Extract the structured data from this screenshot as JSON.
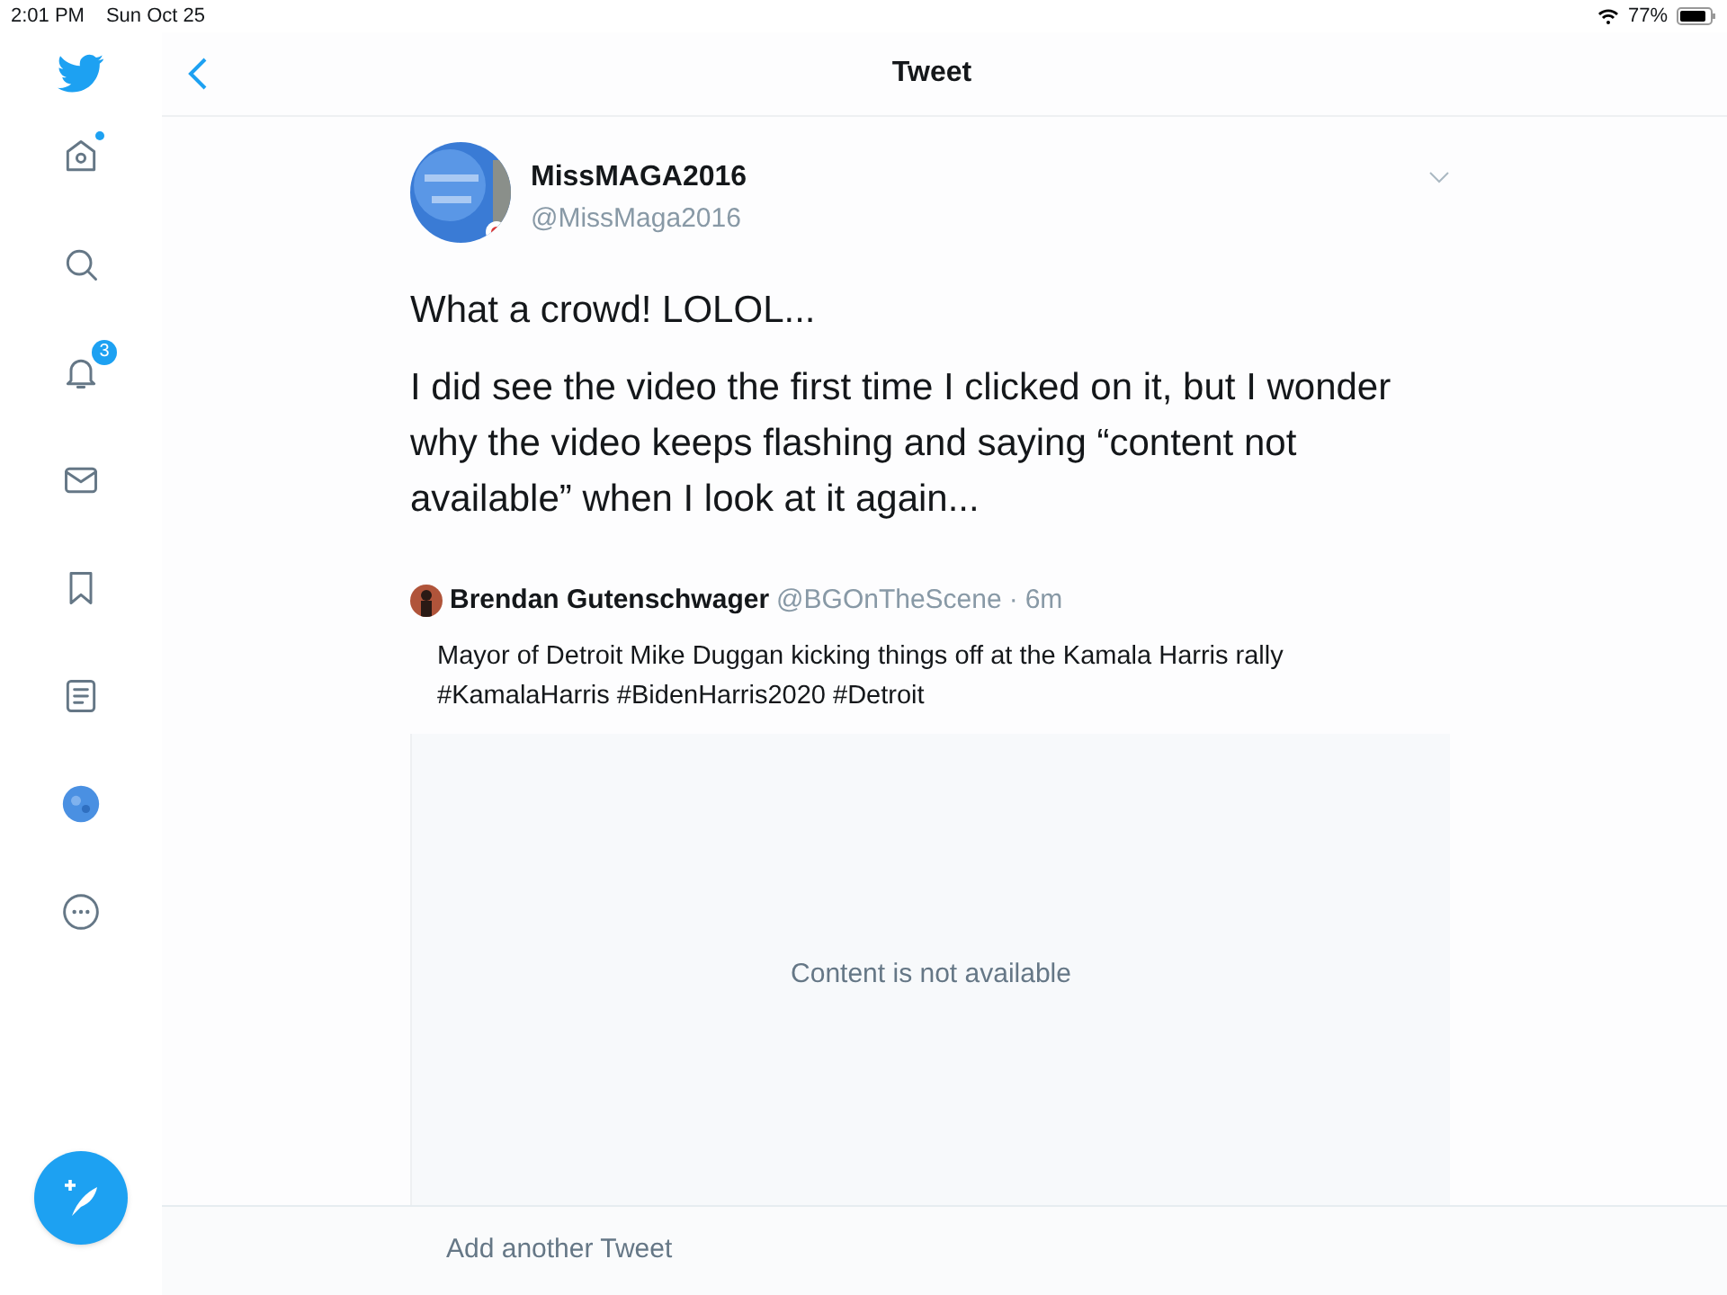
{
  "status_bar": {
    "time": "2:01 PM",
    "date": "Sun Oct 25",
    "battery": "77%"
  },
  "header": {
    "title": "Tweet"
  },
  "sidebar": {
    "items": [
      {
        "kind": "home",
        "dot": true
      },
      {
        "kind": "search",
        "dot": false
      },
      {
        "kind": "notifications",
        "dot": false,
        "badge": "3"
      },
      {
        "kind": "messages",
        "dot": false
      },
      {
        "kind": "bookmarks",
        "dot": false
      },
      {
        "kind": "lists",
        "dot": false
      },
      {
        "kind": "profile",
        "dot": false
      },
      {
        "kind": "more",
        "dot": false
      }
    ]
  },
  "tweet": {
    "author": "MissMAGA2016",
    "handle": "@MissMaga2016",
    "paragraphs": [
      "What a crowd! LOLOL...",
      "I did see the video the first time I clicked on it, but I wonder why the video keeps flashing and saying “content not available” when I look at it again..."
    ],
    "quote": {
      "author": "Brendan Gutenschwager",
      "handle": "@BGOnTheScene",
      "separator": "·",
      "time": "6m",
      "text": "Mayor of Detroit Mike Duggan kicking things off at the Kamala Harris rally #KamalaHarris #BidenHarris2020 #Detroit",
      "media_message": "Content is not available"
    }
  },
  "reply": {
    "placeholder": "Add another Tweet"
  }
}
